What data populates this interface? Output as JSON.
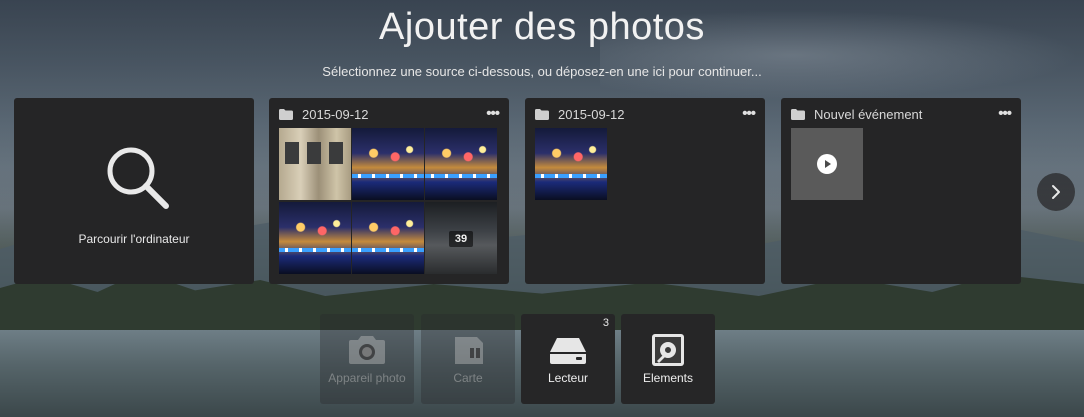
{
  "header": {
    "title": "Ajouter des photos",
    "subtitle": "Sélectionnez une source ci-dessous, ou déposez-en une ici pour continuer..."
  },
  "browse": {
    "label": "Parcourir l'ordinateur",
    "icon": "search-icon"
  },
  "events": [
    {
      "title": "2015-09-12",
      "more": "•••",
      "thumb_count": 6,
      "overflow_count": "39"
    },
    {
      "title": "2015-09-12",
      "more": "•••",
      "thumb_count": 1
    },
    {
      "title": "Nouvel événement",
      "more": "•••",
      "kind": "video"
    }
  ],
  "navigation": {
    "next_icon": "chevron-right-icon"
  },
  "sources": [
    {
      "label": "Appareil photo",
      "icon": "camera-icon",
      "enabled": false
    },
    {
      "label": "Carte",
      "icon": "memory-card-icon",
      "enabled": false
    },
    {
      "label": "Lecteur",
      "icon": "drive-icon",
      "enabled": true,
      "badge": "3"
    },
    {
      "label": "Elements",
      "icon": "elements-icon",
      "enabled": true
    }
  ],
  "colors": {
    "card_bg": "#252526",
    "text_primary": "#ffffff",
    "text_muted": "#d8d8d8"
  }
}
